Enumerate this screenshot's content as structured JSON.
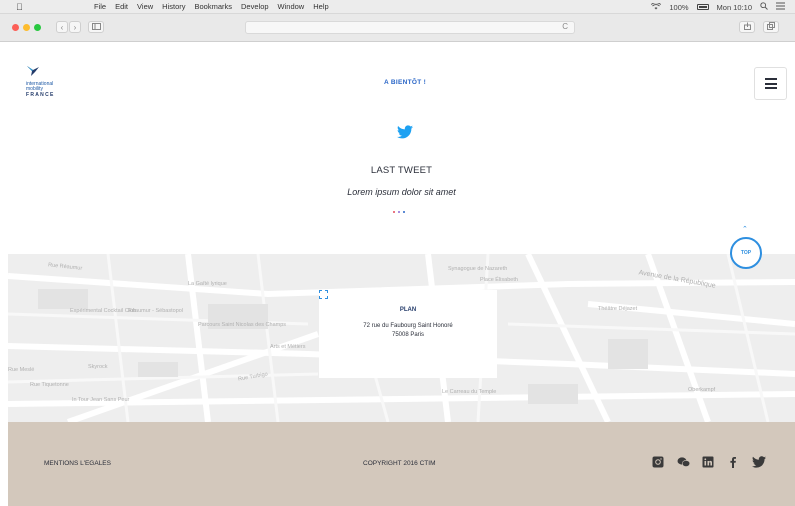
{
  "menubar": {
    "apple": "",
    "items": [
      "File",
      "Edit",
      "View",
      "History",
      "Bookmarks",
      "Develop",
      "Window",
      "Help"
    ],
    "wifi": "",
    "battery": "100%",
    "clock": "Mon 10:10"
  },
  "browser": {
    "reload": "C"
  },
  "header": {
    "logo": {
      "line1": "international",
      "line2": "mobility",
      "line3": "FRANCE"
    },
    "nav_link": "A BIENTÔT !"
  },
  "tweet": {
    "title": "LAST TWEET",
    "text": "Lorem ipsum dolor sit amet"
  },
  "top_button": "TOP",
  "map": {
    "labels": [
      "Rue Réaumur",
      "La Gaîté lyrique",
      "Synagogue de Nazareth",
      "Place Élisabeth",
      "Avenue de la République",
      "Expérimental Cocktail Club",
      "Réaumur - Sébastopol",
      "Parcours Saint Nicolas des Champs",
      "Théâtre Déjazet",
      "Arts et Métiers",
      "Skyrock",
      "Rue Turbigo",
      "Rue Tiquetonne",
      "Le Carreau du Temple",
      "Oberkampf",
      "In Tour Jean Sans Peur",
      "Rue Meslé"
    ],
    "card": {
      "title": "PLAN",
      "address_line1": "72 rue du Faubourg Saint Honoré",
      "address_line2": "75008 Paris"
    }
  },
  "footer": {
    "left": "MENTIONS L'EGALES",
    "center": "COPYRIGHT 2016 CTIM",
    "socials": [
      "instagram-icon",
      "wechat-icon",
      "linkedin-icon",
      "facebook-icon",
      "twitter-icon"
    ]
  },
  "colors": {
    "accent_blue": "#2a66c7",
    "twitter_blue": "#1da1f2",
    "footer_bg": "#d3c8bc",
    "map_bg": "#eeeeee"
  }
}
